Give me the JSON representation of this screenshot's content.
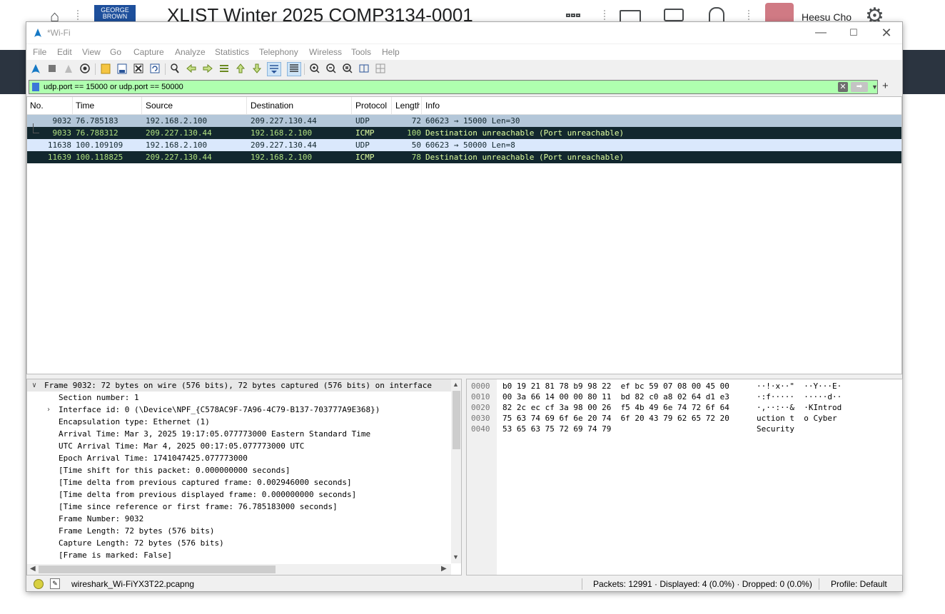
{
  "background": {
    "course_title": "XLIST Winter 2025 COMP3134-0001",
    "logo_text": "GEORGE BROWN",
    "user_name": "Heesu Cho"
  },
  "window": {
    "title": "*Wi-Fi"
  },
  "menu": [
    "File",
    "Edit",
    "View",
    "Go",
    "Capture",
    "Analyze",
    "Statistics",
    "Telephony",
    "Wireless",
    "Tools",
    "Help"
  ],
  "filter": {
    "value": "udp.port == 15000 or udp.port == 50000",
    "bg_color": "#afffaf"
  },
  "packet_list": {
    "columns": [
      "No.",
      "Time",
      "Source",
      "Destination",
      "Protocol",
      "Length",
      "Info"
    ],
    "rows": [
      {
        "no": "9032",
        "time": "76.785183",
        "src": "192.168.2.100",
        "dst": "209.227.130.44",
        "proto": "UDP",
        "len": "72",
        "info": "60623 → 15000 Len=30"
      },
      {
        "no": "9033",
        "time": "76.788312",
        "src": "209.227.130.44",
        "dst": "192.168.2.100",
        "proto": "ICMP",
        "len": "100",
        "info": "Destination unreachable (Port unreachable)"
      },
      {
        "no": "11638",
        "time": "100.109109",
        "src": "192.168.2.100",
        "dst": "209.227.130.44",
        "proto": "UDP",
        "len": "50",
        "info": "60623 → 50000 Len=8"
      },
      {
        "no": "11639",
        "time": "100.118825",
        "src": "209.227.130.44",
        "dst": "192.168.2.100",
        "proto": "ICMP",
        "len": "78",
        "info": "Destination unreachable (Port unreachable)"
      }
    ]
  },
  "details": {
    "lines": [
      "Frame 9032: 72 bytes on wire (576 bits), 72 bytes captured (576 bits) on interface",
      "Section number: 1",
      "Interface id: 0 (\\Device\\NPF_{C578AC9F-7A96-4C79-B137-703777A9E368})",
      "Encapsulation type: Ethernet (1)",
      "Arrival Time: Mar  3, 2025 19:17:05.077773000 Eastern Standard Time",
      "UTC Arrival Time: Mar  4, 2025 00:17:05.077773000 UTC",
      "Epoch Arrival Time: 1741047425.077773000",
      "[Time shift for this packet: 0.000000000 seconds]",
      "[Time delta from previous captured frame: 0.002946000 seconds]",
      "[Time delta from previous displayed frame: 0.000000000 seconds]",
      "[Time since reference or first frame: 76.785183000 seconds]",
      "Frame Number: 9032",
      "Frame Length: 72 bytes (576 bits)",
      "Capture Length: 72 bytes (576 bits)",
      "[Frame is marked: False]"
    ]
  },
  "bytes": {
    "rows": [
      {
        "offset": "0000",
        "hex": "b0 19 21 81 78 b9 98 22  ef bc 59 07 08 00 45 00",
        "ascii": "··!·x··\"  ··Y···E·"
      },
      {
        "offset": "0010",
        "hex": "00 3a 66 14 00 00 80 11  bd 82 c0 a8 02 64 d1 e3",
        "ascii": "·:f·····  ·····d··"
      },
      {
        "offset": "0020",
        "hex": "82 2c ec cf 3a 98 00 26  f5 4b 49 6e 74 72 6f 64",
        "ascii": "·,··:··&  ·KIntrod"
      },
      {
        "offset": "0030",
        "hex": "75 63 74 69 6f 6e 20 74  6f 20 43 79 62 65 72 20",
        "ascii": "uction t  o Cyber "
      },
      {
        "offset": "0040",
        "hex": "53 65 63 75 72 69 74 79",
        "ascii": "Security"
      }
    ]
  },
  "status": {
    "file": "wireshark_Wi-FiYX3T22.pcapng",
    "packets": "Packets: 12991 · Displayed: 4 (0.0%) · Dropped: 0 (0.0%)",
    "profile": "Profile: Default"
  }
}
